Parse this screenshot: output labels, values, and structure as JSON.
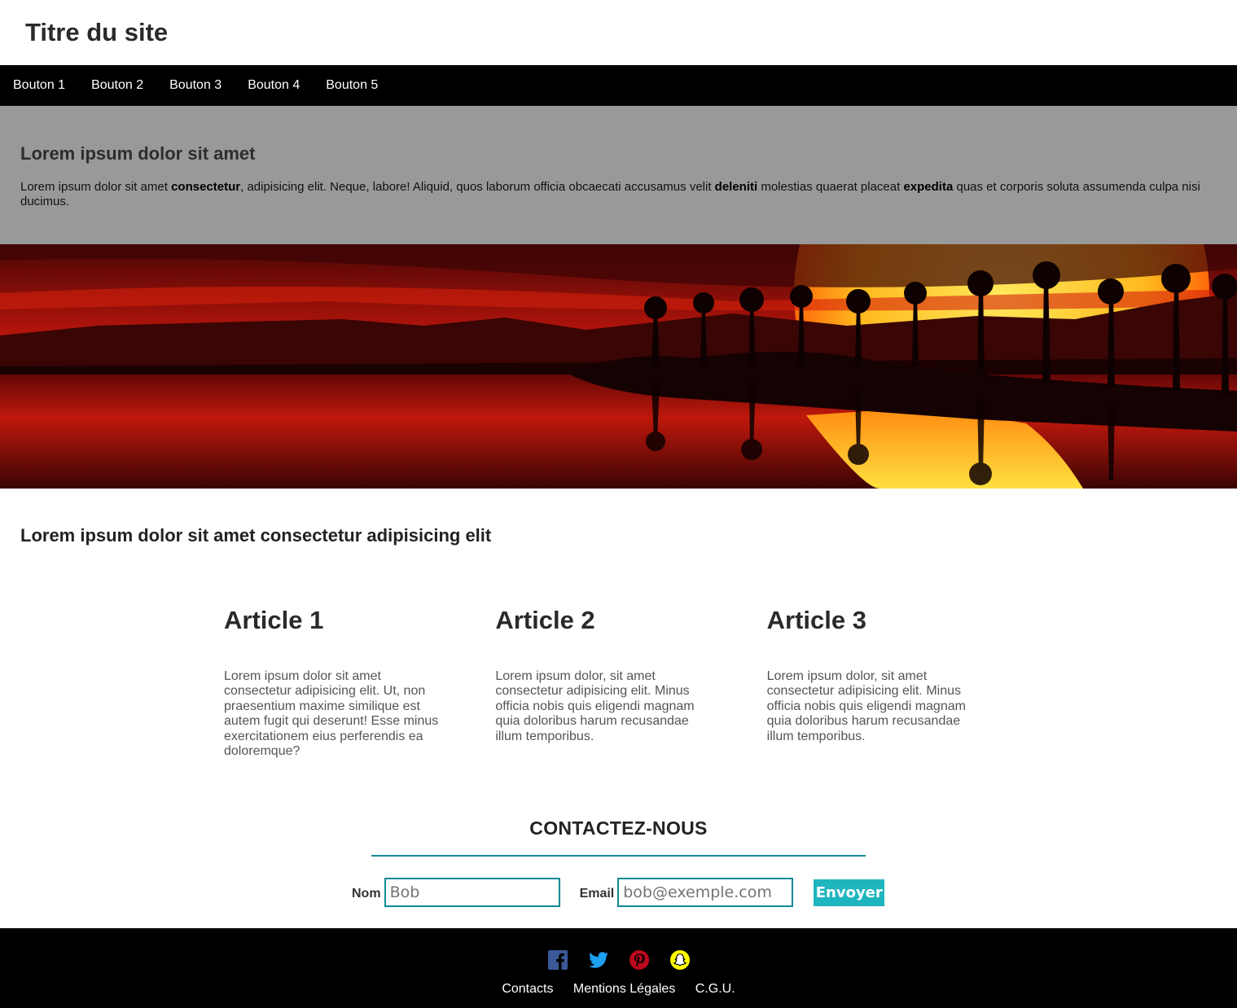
{
  "header": {
    "title": "Titre du site"
  },
  "nav": {
    "items": [
      "Bouton 1",
      "Bouton 2",
      "Bouton 3",
      "Bouton 4",
      "Bouton 5"
    ]
  },
  "intro": {
    "heading": "Lorem ipsum dolor sit amet",
    "text_parts": [
      "Lorem ipsum dolor sit amet ",
      "consectetur",
      ", adipisicing elit. Neque, labore! Aliquid, quos laborum officia obcaecati accusamus velit ",
      "deleniti",
      " molestias quaerat placeat ",
      "expedita",
      " quas et corporis soluta assumenda culpa nisi ducimus."
    ]
  },
  "section": {
    "title": "Lorem ipsum dolor sit amet consectetur adipisicing elit"
  },
  "articles": [
    {
      "title": "Article 1",
      "text": "Lorem ipsum dolor sit amet consectetur adipisicing elit. Ut, non praesentium maxime similique est autem fugit qui deserunt! Esse minus exercitationem eius perferendis ea doloremque?"
    },
    {
      "title": "Article 2",
      "text": "Lorem ipsum dolor, sit amet consectetur adipisicing elit. Minus officia nobis quis eligendi magnam quia doloribus harum recusandae illum temporibus."
    },
    {
      "title": "Article 3",
      "text": "Lorem ipsum dolor, sit amet consectetur adipisicing elit. Minus officia nobis quis eligendi magnam quia doloribus harum recusandae illum temporibus."
    }
  ],
  "contact": {
    "title": "CONTACTEZ-NOUS",
    "name_label": "Nom",
    "name_placeholder": "Bob",
    "email_label": "Email",
    "email_placeholder": "bob@exemple.com",
    "submit_label": "Envoyer",
    "accent_color": "#118a95",
    "button_color": "#1fb5be"
  },
  "footer": {
    "social_icons": [
      "facebook-icon",
      "twitter-icon",
      "pinterest-icon",
      "snapchat-icon"
    ],
    "links": [
      "Contacts",
      "Mentions Légales",
      "C.G.U."
    ]
  }
}
